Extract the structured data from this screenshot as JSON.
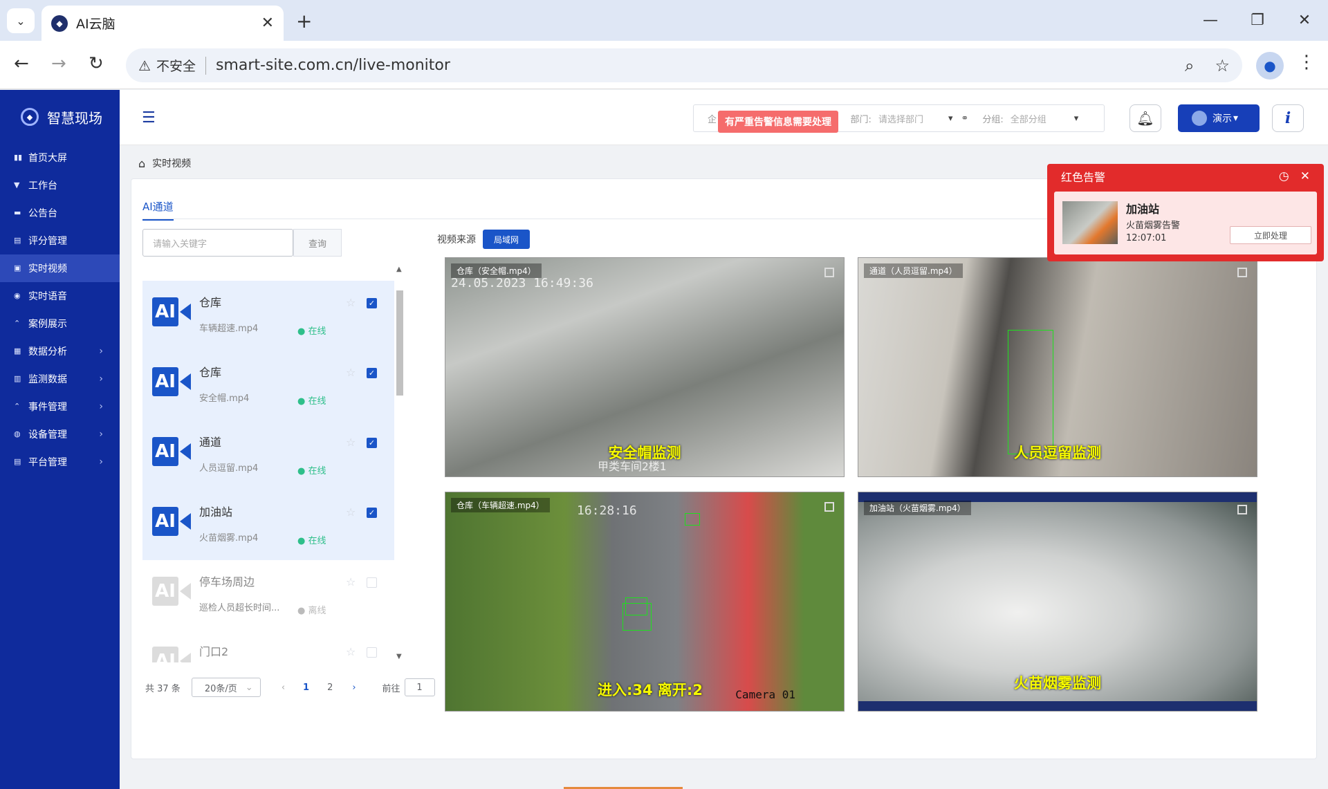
{
  "browser": {
    "tab_title": "AI云脑",
    "insecure_label": "不安全",
    "url": "smart-site.com.cn/live-monitor"
  },
  "sidebar": {
    "brand": "智慧现场",
    "items": [
      {
        "label": "首页大屏",
        "icon": "dashboard-icon",
        "expandable": false,
        "active": false
      },
      {
        "label": "工作台",
        "icon": "workbench-icon",
        "expandable": false,
        "active": false
      },
      {
        "label": "公告台",
        "icon": "notice-icon",
        "expandable": false,
        "active": false
      },
      {
        "label": "评分管理",
        "icon": "score-icon",
        "expandable": false,
        "active": false
      },
      {
        "label": "实时视频",
        "icon": "video-icon",
        "expandable": false,
        "active": true
      },
      {
        "label": "实时语音",
        "icon": "voice-icon",
        "expandable": false,
        "active": false
      },
      {
        "label": "案例展示",
        "icon": "case-icon",
        "expandable": false,
        "active": false
      },
      {
        "label": "数据分析",
        "icon": "analysis-icon",
        "expandable": true,
        "active": false
      },
      {
        "label": "监测数据",
        "icon": "monitor-data-icon",
        "expandable": true,
        "active": false
      },
      {
        "label": "事件管理",
        "icon": "event-icon",
        "expandable": true,
        "active": false
      },
      {
        "label": "设备管理",
        "icon": "device-icon",
        "expandable": true,
        "active": false
      },
      {
        "label": "平台管理",
        "icon": "platform-icon",
        "expandable": true,
        "active": false
      }
    ]
  },
  "header": {
    "company_label_partial": "企",
    "dept_label": "部门:",
    "dept_placeholder": "请选择部门",
    "group_label": "分组:",
    "group_value": "全部分组",
    "alarm_notice": "有严重告警信息需要处理",
    "user_name": "演示"
  },
  "breadcrumb": {
    "current": "实时视频"
  },
  "main": {
    "tab_label": "AI通道",
    "search_placeholder": "请输入关键字",
    "search_button": "查询",
    "source_label": "视频来源",
    "source_button": "局域网"
  },
  "channels": [
    {
      "name": "仓库",
      "file": "车辆超速.mp4",
      "status": "在线",
      "selected": true
    },
    {
      "name": "仓库",
      "file": "安全帽.mp4",
      "status": "在线",
      "selected": true
    },
    {
      "name": "通道",
      "file": "人员逗留.mp4",
      "status": "在线",
      "selected": true
    },
    {
      "name": "加油站",
      "file": "火苗烟雾.mp4",
      "status": "在线",
      "selected": true
    },
    {
      "name": "停车场周边",
      "file": "巡检人员超长时间...",
      "status": "离线",
      "selected": false
    },
    {
      "name": "门口2",
      "file": "",
      "status": "",
      "selected": false
    }
  ],
  "pagination": {
    "total": "共 37 条",
    "page_size": "20条/页",
    "pages": [
      "1",
      "2"
    ],
    "current_page": "1",
    "goto_label": "前往",
    "goto_value": "1"
  },
  "videos": [
    {
      "tag": "仓库（安全帽.mp4）",
      "overlay": "安全帽监测",
      "timestamp": "24.05.2023 16:49:36",
      "caption": "甲类车间2楼1"
    },
    {
      "tag": "通道（人员逗留.mp4）",
      "overlay": "人员逗留监测",
      "timestamp": "",
      "caption": ""
    },
    {
      "tag": "仓库（车辆超速.mp4）",
      "overlay": "进入:34  离开:2",
      "timestamp": "16:28:16",
      "caption": "Camera 01"
    },
    {
      "tag": "加油站（火苗烟雾.mp4）",
      "overlay": "火苗烟雾监测",
      "timestamp": "",
      "caption": ""
    }
  ],
  "alert_popup": {
    "title": "红色告警",
    "site": "加油站",
    "type": "火苗烟雾告警",
    "time": "12:07:01",
    "action_button": "立即处理"
  },
  "colors": {
    "sidebar_bg": "#0f2b9c",
    "accent": "#1a55c8",
    "alert_red": "#e22b2b",
    "online_green": "#2ebf8a"
  }
}
